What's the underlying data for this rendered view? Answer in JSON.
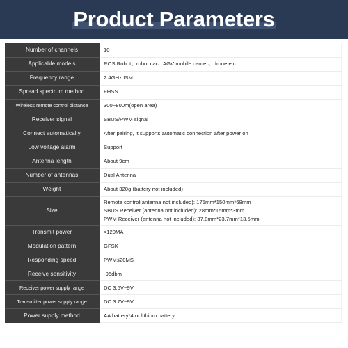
{
  "header": {
    "title": "Product Parameters",
    "background_color": "#2b3a54",
    "underbar_color": "#3f5170",
    "title_color": "#ffffff"
  },
  "table": {
    "label_column_color": "#3a3a3a",
    "label_text_color": "#f0f0f0",
    "value_text_color": "#222222",
    "rows": [
      {
        "label": "Number of channels",
        "value_lines": [
          "10"
        ]
      },
      {
        "label": "Applicable models",
        "value_lines": [
          "ROS Robot、robot car、AGV mobile carrier、drone etc"
        ]
      },
      {
        "label": "Frequency range",
        "value_lines": [
          "2.4GHz  ISM"
        ]
      },
      {
        "label": "Spread spectrum method",
        "value_lines": [
          "FHSS"
        ]
      },
      {
        "label": "Wireless remote control distance",
        "value_lines": [
          "300~800m(open area)"
        ]
      },
      {
        "label": "Receiver signal",
        "value_lines": [
          "SBUS/PWM signal"
        ]
      },
      {
        "label": "Connect automatically",
        "value_lines": [
          "After pairing, it supports automatic connection after power on"
        ]
      },
      {
        "label": "Low voltage alarm",
        "value_lines": [
          "Support"
        ]
      },
      {
        "label": "Antenna length",
        "value_lines": [
          "About 9cm"
        ]
      },
      {
        "label": "Number of antennas",
        "value_lines": [
          "Dual Antenna"
        ]
      },
      {
        "label": "Weight",
        "value_lines": [
          "About 320g (battery not included)"
        ]
      },
      {
        "label": "Size",
        "value_lines": [
          "Remote control(antenna not included):  175mm*150mm*68mm",
          "SBUS Receiver (antenna not included):  28mm*15mm*3mm",
          "PWM Receiver (antenna not included):  37.8mm*23.7mm*13.5mm"
        ]
      },
      {
        "label": "Transmit power",
        "value_lines": [
          "≈120MA"
        ]
      },
      {
        "label": "Modulation pattern",
        "value_lines": [
          "GFSK"
        ]
      },
      {
        "label": "Responding speed",
        "value_lines": [
          "PWM≤20MS"
        ]
      },
      {
        "label": "Receive sensitivity",
        "value_lines": [
          "-96dbm"
        ]
      },
      {
        "label": "Receiver power supply range",
        "value_lines": [
          "DC 3.5V~9V"
        ]
      },
      {
        "label": "Transmitter power supply range",
        "value_lines": [
          "DC 3.7V~9V"
        ]
      },
      {
        "label": "Power supply method",
        "value_lines": [
          "AA battery*4 or lithium battery"
        ]
      }
    ]
  }
}
